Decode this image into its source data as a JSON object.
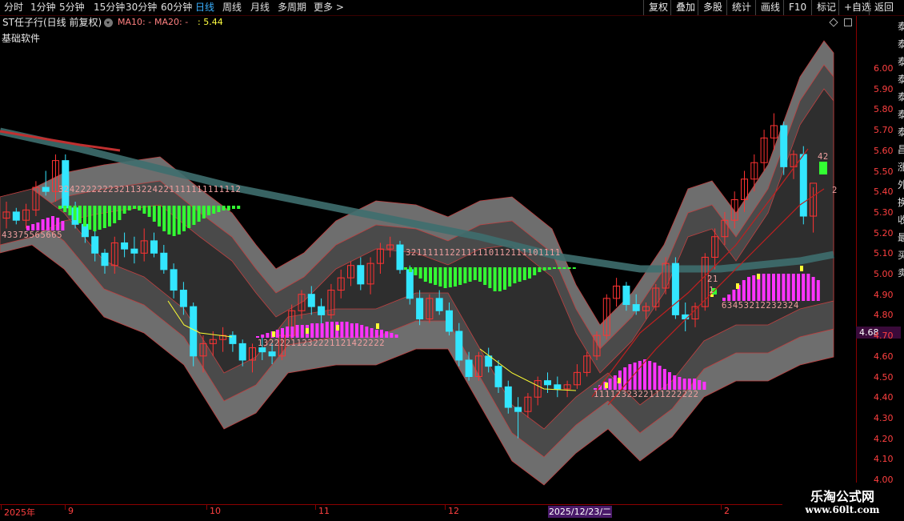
{
  "toolbar": {
    "periods": [
      "分时",
      "1分钟",
      "5分钟",
      "15分钟",
      "30分钟",
      "60分钟",
      "日线",
      "周线",
      "月线",
      "多周期",
      "更多 >"
    ],
    "active_period": "日线",
    "right_buttons": [
      "复权",
      "叠加",
      "多股",
      "统计",
      "画线",
      "F10",
      "标记",
      "+自选",
      "返回"
    ]
  },
  "header": {
    "stock_name": "ST任子行(日线 前复权)",
    "ma10": "MA10: -",
    "ma20": "MA20: -",
    "ma20_value": ": 5.44",
    "software": "基础软件"
  },
  "price_axis": {
    "ticks": [
      "6.00",
      "5.90",
      "5.80",
      "5.70",
      "5.60",
      "5.50",
      "5.40",
      "5.30",
      "5.20",
      "5.10",
      "5.00",
      "4.90",
      "4.80",
      "4.70",
      "4.60",
      "4.50",
      "4.40",
      "4.30",
      "4.20",
      "4.10",
      "4.00"
    ],
    "current_price": "4.68"
  },
  "date_axis": {
    "labels": [
      "2025年",
      "9",
      "10",
      "11",
      "12",
      "2"
    ],
    "highlight": "2025/12/23/二"
  },
  "sequences": {
    "s1": "324222222232113224221111111111112",
    "s2": "43375565665",
    "s3": "3211111122111110112111101111",
    "s4": "13222211232221121422222",
    "s5": "1111232322111222222",
    "s6": "63453212232324",
    "s7": "21",
    "s8": "1",
    "s9": "42",
    "s10": "2"
  },
  "right_strip": [
    "泰",
    "泰",
    "泰",
    "泰",
    "泰",
    "泰",
    "泰",
    "昌",
    "涨",
    "外",
    "换",
    "收",
    "最",
    "买",
    "卖"
  ],
  "watermark": {
    "line1": "乐淘公式网",
    "line2": "www.60lt.com"
  },
  "colors": {
    "up": "#ff3333",
    "down": "#33e6ff",
    "macd_pos": "#ff33ff",
    "macd_neg": "#33ff33",
    "band_outer": "#6e6e6e",
    "band_mid": "#4a4a4a",
    "band_inner": "#2e2e2e",
    "ma_long": "#3e6e6e",
    "ma_short": "#ffff33"
  },
  "chart_data": {
    "type": "candlestick",
    "x_range": [
      "2025-08",
      "2026-02"
    ],
    "ylim": [
      4.0,
      6.0
    ],
    "candles_ohlc_approx": [
      [
        5.27,
        5.35,
        5.22,
        5.3
      ],
      [
        5.3,
        5.32,
        5.24,
        5.26
      ],
      [
        5.26,
        5.34,
        5.22,
        5.31
      ],
      [
        5.31,
        5.45,
        5.28,
        5.42
      ],
      [
        5.42,
        5.5,
        5.38,
        5.4
      ],
      [
        5.4,
        5.58,
        5.35,
        5.55
      ],
      [
        5.55,
        5.58,
        5.3,
        5.32
      ],
      [
        5.32,
        5.35,
        5.22,
        5.24
      ],
      [
        5.24,
        5.28,
        5.15,
        5.18
      ],
      [
        5.18,
        5.22,
        5.06,
        5.1
      ],
      [
        5.1,
        5.12,
        5.0,
        5.04
      ],
      [
        5.04,
        5.18,
        5.0,
        5.15
      ],
      [
        5.15,
        5.2,
        5.08,
        5.12
      ],
      [
        5.12,
        5.18,
        5.05,
        5.1
      ],
      [
        5.1,
        5.22,
        5.06,
        5.16
      ],
      [
        5.16,
        5.2,
        5.08,
        5.1
      ],
      [
        5.1,
        5.14,
        5.0,
        5.02
      ],
      [
        5.02,
        5.05,
        4.88,
        4.92
      ],
      [
        4.92,
        4.96,
        4.8,
        4.84
      ],
      [
        4.84,
        4.86,
        4.55,
        4.6
      ],
      [
        4.6,
        4.7,
        4.52,
        4.66
      ],
      [
        4.66,
        4.72,
        4.6,
        4.68
      ],
      [
        4.68,
        4.74,
        4.62,
        4.7
      ],
      [
        4.7,
        4.72,
        4.62,
        4.66
      ],
      [
        4.66,
        4.68,
        4.55,
        4.58
      ],
      [
        4.58,
        4.66,
        4.52,
        4.64
      ],
      [
        4.64,
        4.7,
        4.58,
        4.62
      ],
      [
        4.62,
        4.66,
        4.56,
        4.6
      ],
      [
        4.6,
        4.72,
        4.58,
        4.7
      ],
      [
        4.7,
        4.85,
        4.68,
        4.82
      ],
      [
        4.82,
        4.92,
        4.78,
        4.9
      ],
      [
        4.9,
        4.94,
        4.8,
        4.84
      ],
      [
        4.84,
        4.88,
        4.75,
        4.8
      ],
      [
        4.8,
        4.95,
        4.78,
        4.92
      ],
      [
        4.92,
        5.02,
        4.88,
        4.98
      ],
      [
        4.98,
        5.06,
        4.94,
        5.04
      ],
      [
        5.04,
        5.08,
        4.92,
        4.95
      ],
      [
        4.95,
        5.08,
        4.9,
        5.05
      ],
      [
        5.05,
        5.15,
        5.0,
        5.12
      ],
      [
        5.12,
        5.18,
        5.08,
        5.14
      ],
      [
        5.14,
        5.16,
        5.0,
        5.02
      ],
      [
        5.02,
        5.04,
        4.85,
        4.88
      ],
      [
        4.88,
        4.92,
        4.75,
        4.78
      ],
      [
        4.78,
        4.9,
        4.76,
        4.88
      ],
      [
        4.88,
        4.92,
        4.8,
        4.82
      ],
      [
        4.82,
        4.86,
        4.7,
        4.72
      ],
      [
        4.72,
        4.76,
        4.55,
        4.58
      ],
      [
        4.58,
        4.62,
        4.48,
        4.5
      ],
      [
        4.5,
        4.62,
        4.48,
        4.6
      ],
      [
        4.6,
        4.64,
        4.52,
        4.55
      ],
      [
        4.55,
        4.58,
        4.42,
        4.45
      ],
      [
        4.45,
        4.48,
        4.32,
        4.35
      ],
      [
        4.35,
        4.4,
        4.2,
        4.33
      ],
      [
        4.33,
        4.42,
        4.3,
        4.4
      ],
      [
        4.4,
        4.5,
        4.36,
        4.48
      ],
      [
        4.48,
        4.52,
        4.42,
        4.46
      ],
      [
        4.46,
        4.5,
        4.4,
        4.44
      ],
      [
        4.44,
        4.48,
        4.4,
        4.46
      ],
      [
        4.46,
        4.56,
        4.44,
        4.52
      ],
      [
        4.52,
        4.62,
        4.5,
        4.6
      ],
      [
        4.6,
        4.72,
        4.58,
        4.7
      ],
      [
        4.7,
        4.9,
        4.68,
        4.88
      ],
      [
        4.88,
        4.98,
        4.84,
        4.94
      ],
      [
        4.94,
        4.96,
        4.82,
        4.85
      ],
      [
        4.85,
        4.9,
        4.8,
        4.82
      ],
      [
        4.82,
        4.86,
        4.78,
        4.84
      ],
      [
        4.84,
        4.95,
        4.82,
        4.93
      ],
      [
        4.93,
        5.08,
        4.9,
        5.05
      ],
      [
        5.05,
        5.08,
        4.78,
        4.8
      ],
      [
        4.8,
        4.86,
        4.72,
        4.78
      ],
      [
        4.78,
        4.86,
        4.74,
        4.84
      ],
      [
        4.84,
        5.1,
        4.82,
        5.08
      ],
      [
        5.08,
        5.22,
        5.02,
        5.18
      ],
      [
        5.18,
        5.3,
        5.14,
        5.26
      ],
      [
        5.26,
        5.4,
        5.22,
        5.36
      ],
      [
        5.36,
        5.5,
        5.3,
        5.46
      ],
      [
        5.46,
        5.58,
        5.4,
        5.54
      ],
      [
        5.54,
        5.7,
        5.5,
        5.66
      ],
      [
        5.66,
        5.78,
        5.6,
        5.72
      ],
      [
        5.72,
        5.74,
        5.48,
        5.52
      ],
      [
        5.52,
        5.6,
        5.46,
        5.58
      ],
      [
        5.58,
        5.62,
        5.24,
        5.28
      ],
      [
        5.28,
        5.42,
        5.2,
        5.44
      ]
    ]
  }
}
